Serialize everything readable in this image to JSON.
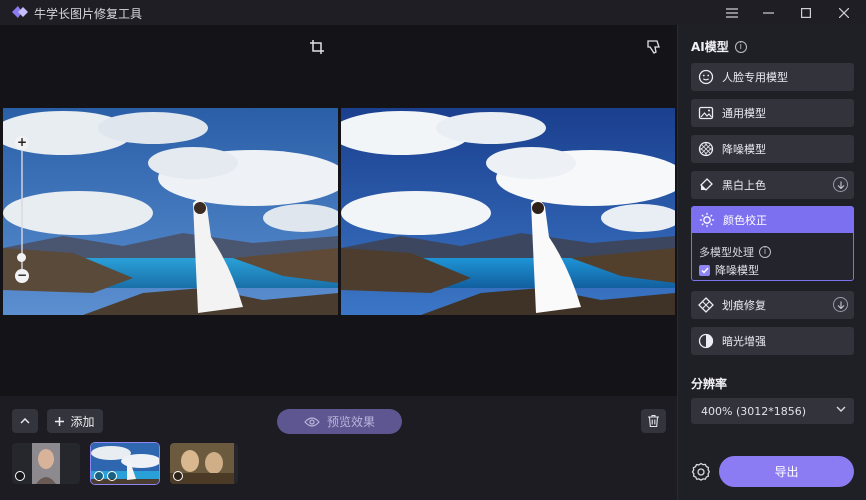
{
  "app": {
    "title": "牛学长图片修复工具"
  },
  "colors": {
    "accent": "#8c7cf4",
    "active_head": "#7c6ff0",
    "panel_bg": "#1f1f26"
  },
  "toolbar": {
    "add_label": "添加",
    "preview_label": "预览效果"
  },
  "panel": {
    "ai_title": "AI模型",
    "models": [
      {
        "label": "人脸专用模型",
        "icon": "face-icon"
      },
      {
        "label": "通用模型",
        "icon": "image-icon"
      },
      {
        "label": "降噪模型",
        "icon": "denoise-icon"
      },
      {
        "label": "黑白上色",
        "icon": "colorize-icon",
        "expandable": true
      },
      {
        "label": "颜色校正",
        "icon": "sun-icon",
        "active": true
      },
      {
        "label": "划痕修复",
        "icon": "scratch-icon",
        "expandable": true
      },
      {
        "label": "暗光增强",
        "icon": "contrast-icon"
      }
    ],
    "multi_model_label": "多模型处理",
    "multi_model_checked": "降噪模型",
    "resolution_title": "分辨率",
    "resolution_value": "400% (3012*1856)",
    "export_label": "导出"
  }
}
